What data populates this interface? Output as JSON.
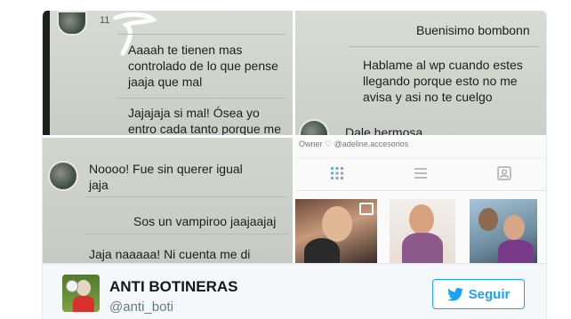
{
  "photo1": {
    "header_fragment": "11",
    "messages": [
      "Aaaah te tienen mas\ncontrolado de lo que pense\njaaja que mal",
      "Jajajaja si mal! Ósea yo\nentro cada tanto porque me"
    ]
  },
  "photo2": {
    "messages": [
      "Buenisimo bombonn",
      "Hablame al wp cuando estes\nllegando porque esto no me\navisa y asi no te cuelgo",
      "Dale hermosa"
    ]
  },
  "photo3": {
    "messages": [
      "Noooo! Fue sin querer igual\njaja",
      "Sos un vampiroo jaajaajaj",
      "Jaja naaaaa! Ni cuenta me di\njajaja"
    ]
  },
  "photo4": {
    "owner_text": "Owner ♡ @adeline.accesorios",
    "tabs": [
      "grid-icon",
      "list-icon",
      "tagged-icon"
    ]
  },
  "footer": {
    "display_name": "ANTI BOTINERAS",
    "handle": "@anti_boti",
    "follow_label": "Seguir"
  },
  "colors": {
    "twitter_blue": "#1da1f2",
    "name_text": "#14171a",
    "handle_text": "#657786"
  }
}
